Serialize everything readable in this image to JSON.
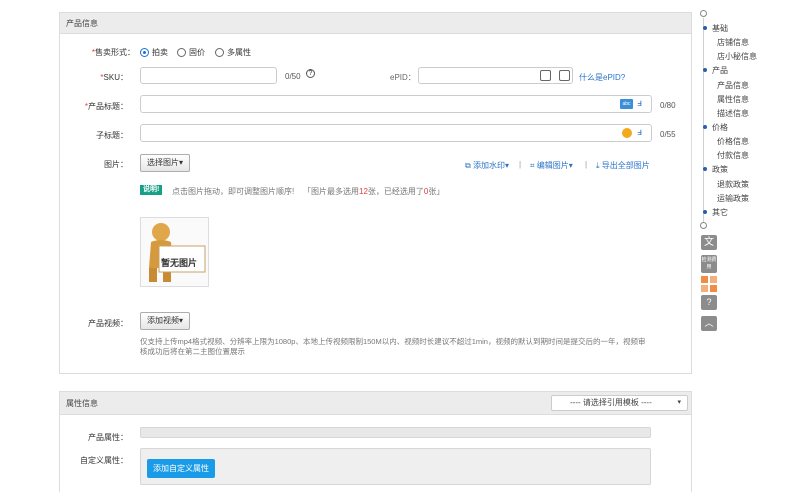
{
  "panel_product": {
    "title": "产品信息",
    "sale_form": {
      "label": "售卖形式：",
      "options": [
        "拍卖",
        "固价",
        "多属性"
      ],
      "selected": "拍卖"
    },
    "sku": {
      "label": "SKU：",
      "value": "",
      "counter": "0/50"
    },
    "epid": {
      "label": "ePID：",
      "value": "",
      "help_link": "什么是ePID?"
    },
    "title_field": {
      "label": "产品标题：",
      "value": "",
      "counter": "0/80",
      "ai_badge": "abc"
    },
    "subtitle": {
      "label": "子标题：",
      "value": "",
      "counter": "0/55"
    },
    "images": {
      "label": "图片：",
      "choose_button": "选择图片▾",
      "watermark_link": "添加水印▾",
      "edit_link": "编辑图片▾",
      "export_link": "导出全部图片",
      "separator": "|",
      "note_badge": "说明!",
      "note_text": "点击图片拖动，即可调整图片顺序!",
      "limit_prefix": "「图片最多选用",
      "limit_max": "12",
      "limit_mid": "张，已经选用了",
      "limit_used": "0",
      "limit_suffix": "张」",
      "placeholder_text": "暂无图片"
    },
    "video": {
      "label": "产品视频：",
      "add_button": "添加视频▾",
      "description": "仅支持上传mp4格式视频、分辨率上限为1080p、本地上传视频限制150M以内、视频时长建议不超过1min，视频的默认到期时间是提交后的一年，视频审核成功后将在第二主图位置展示"
    }
  },
  "panel_attributes": {
    "title": "属性信息",
    "template_select": "---- 请选择引用模板 ----",
    "product_attr_label": "产品属性：",
    "custom_attr_label": "自定义属性：",
    "add_custom_button": "添加自定义属性"
  },
  "right_nav": {
    "groups": [
      {
        "label": "基础",
        "items": [
          "店铺信息",
          "店小秘信息"
        ]
      },
      {
        "label": "产品",
        "items": [
          "产品信息",
          "属性信息",
          "描述信息"
        ]
      },
      {
        "label": "价格",
        "items": [
          "价格信息",
          "付款信息"
        ]
      },
      {
        "label": "政策",
        "items": [
          "退款政策",
          "运输政策"
        ]
      },
      {
        "label": "其它",
        "items": []
      }
    ],
    "check_fee_label": "检测费用",
    "accent_colors": {
      "nav_dot": "#2a5fa8",
      "primary_button": "#1a9be8",
      "link": "#2a73c9",
      "orange_icon": "#f08c45"
    }
  }
}
